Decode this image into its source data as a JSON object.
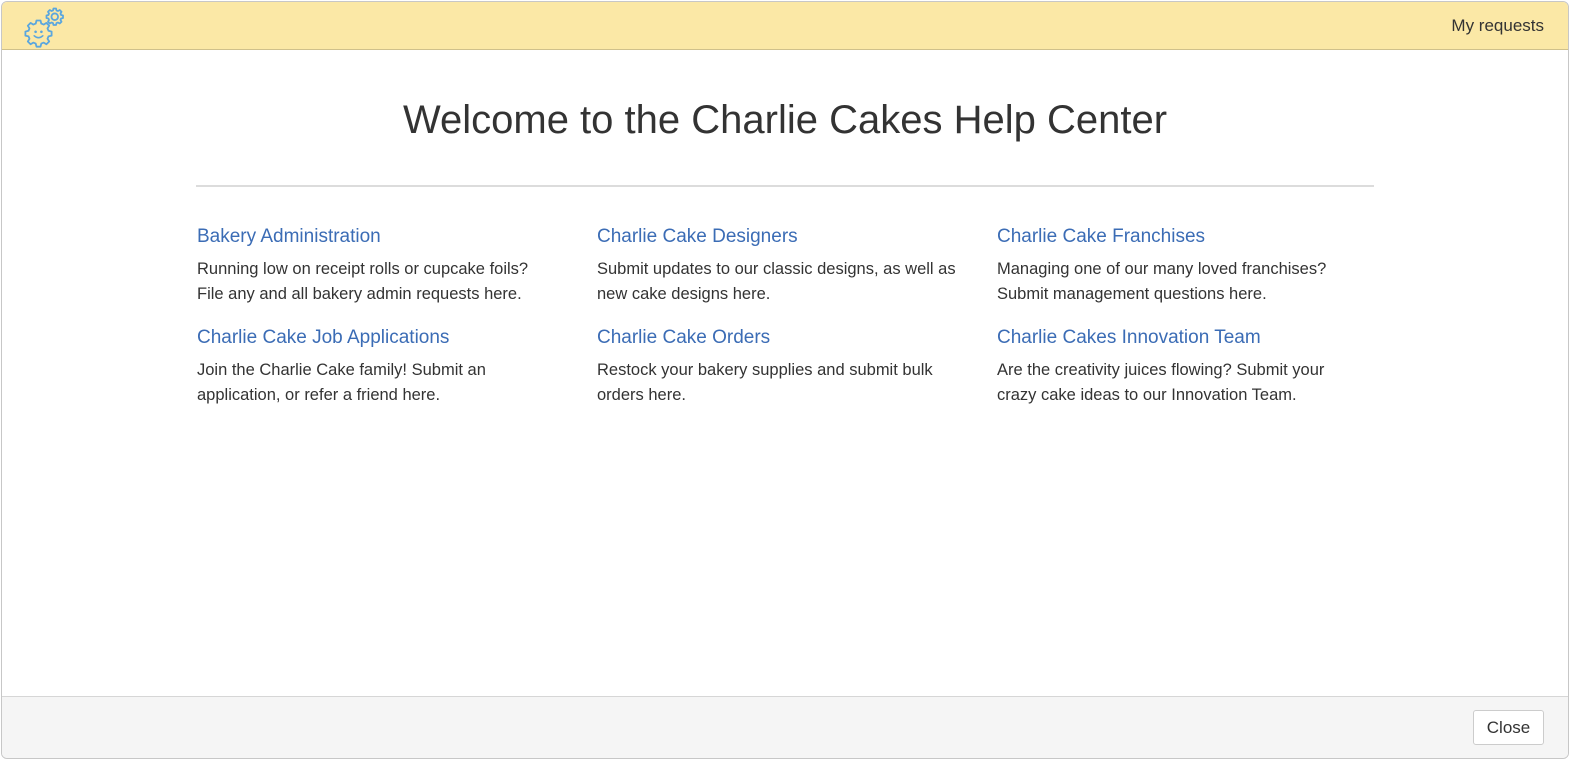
{
  "header": {
    "logo_icon": "gears-icon",
    "my_requests_label": "My requests",
    "accent_color": "#fbe8a6"
  },
  "main": {
    "title": "Welcome to the Charlie Cakes Help Center",
    "link_color": "#3b6cb5",
    "portals": [
      {
        "title": "Bakery Administration",
        "description": "Running low on receipt rolls or cupcake foils? File any and all bakery admin requests here."
      },
      {
        "title": "Charlie Cake Designers",
        "description": "Submit updates to our classic designs, as well as new cake designs here."
      },
      {
        "title": "Charlie Cake Franchises",
        "description": "Managing one of our many loved franchises? Submit management questions here."
      },
      {
        "title": "Charlie Cake Job Applications",
        "description": "Join the Charlie Cake family! Submit an application, or refer a friend here."
      },
      {
        "title": "Charlie Cake Orders",
        "description": "Restock your bakery supplies and submit bulk orders here."
      },
      {
        "title": "Charlie Cakes Innovation Team",
        "description": "Are the creativity juices flowing? Submit your crazy cake ideas to our Innovation Team."
      }
    ]
  },
  "footer": {
    "close_label": "Close"
  }
}
